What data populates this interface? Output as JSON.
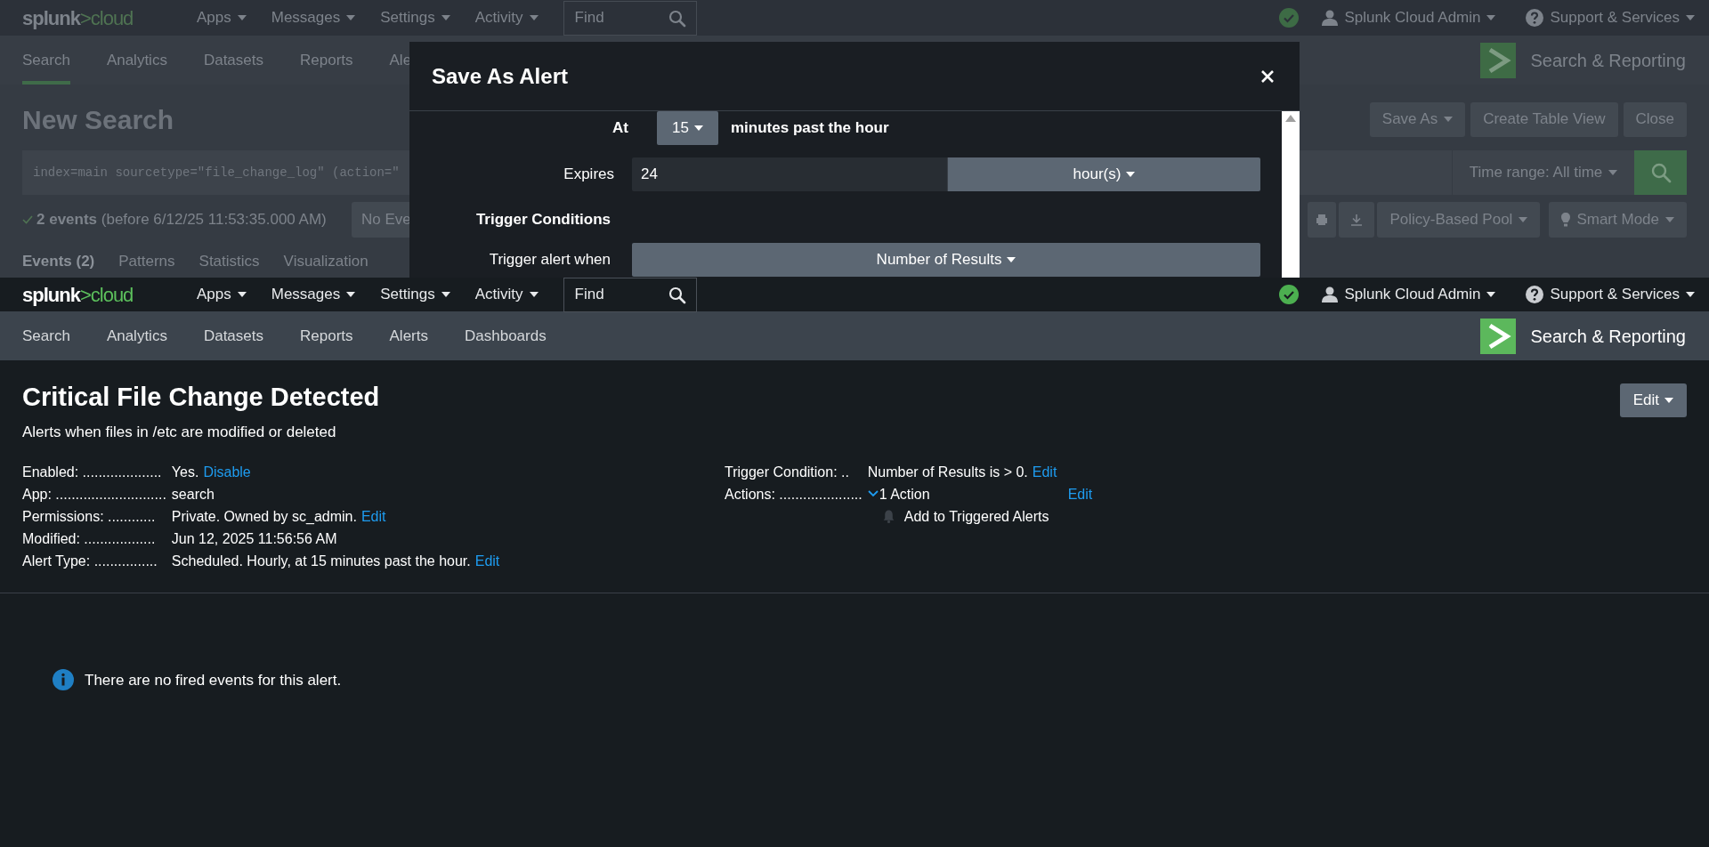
{
  "background_page": {
    "navbar": {
      "logo": {
        "word": "splunk",
        "suffix": ">cloud"
      },
      "menus": [
        "Apps",
        "Messages",
        "Settings",
        "Activity"
      ],
      "find_placeholder": "Find",
      "user": "Splunk Cloud Admin",
      "support": "Support & Services"
    },
    "app_nav": {
      "tabs": [
        {
          "label": "Search",
          "selected": true
        },
        {
          "label": "Analytics",
          "selected": false
        },
        {
          "label": "Datasets",
          "selected": false
        },
        {
          "label": "Reports",
          "selected": false
        },
        {
          "label": "Ale",
          "selected": false
        }
      ],
      "app_name": "Search & Reporting"
    },
    "title": "New Search",
    "actions": [
      {
        "label": "Save As",
        "dropdown": true
      },
      {
        "label": "Create Table View",
        "dropdown": false
      },
      {
        "label": "Close",
        "dropdown": false
      }
    ],
    "query": "index=main sourcetype=\"file_change_log\" (action=\"",
    "time_range": "Time range: All time",
    "events": {
      "count": "2 events",
      "detail": "(before 6/12/25 11:53:35.000 AM)"
    },
    "event_sampling": "No Eve",
    "toolbar": [
      "Policy-Based Pool",
      "Smart Mode"
    ],
    "result_tabs": [
      {
        "label": "Events (2)",
        "selected": true
      },
      {
        "label": "Patterns",
        "selected": false
      },
      {
        "label": "Statistics",
        "selected": false
      },
      {
        "label": "Visualization",
        "selected": false
      }
    ]
  },
  "modal": {
    "title": "Save As Alert",
    "rows": [
      {
        "kind": "minute",
        "label": "At",
        "value": "15",
        "suffix": "minutes past the hour"
      },
      {
        "kind": "expires",
        "label": "Expires",
        "value": "24",
        "unit": "hour(s)"
      },
      {
        "kind": "heading",
        "label": "Trigger Conditions"
      },
      {
        "kind": "select",
        "label": "Trigger alert when",
        "value": "Number of Results"
      }
    ]
  },
  "page": {
    "navbar": {
      "logo": {
        "word": "splunk",
        "suffix": ">cloud"
      },
      "menus": [
        "Apps",
        "Messages",
        "Settings",
        "Activity"
      ],
      "find_placeholder": "Find",
      "user": "Splunk Cloud Admin",
      "support": "Support & Services"
    },
    "app_nav": {
      "tabs": [
        {
          "label": "Search",
          "selected": false
        },
        {
          "label": "Analytics",
          "selected": false
        },
        {
          "label": "Datasets",
          "selected": false
        },
        {
          "label": "Reports",
          "selected": false
        },
        {
          "label": "Alerts",
          "selected": false
        },
        {
          "label": "Dashboards",
          "selected": false
        }
      ],
      "app_name": "Search & Reporting"
    },
    "title": "Critical File Change Detected",
    "description": "Alerts when files in /etc are modified or deleted",
    "edit_button": "Edit",
    "details": [
      {
        "label": "Enabled: ....................",
        "value": "Yes.",
        "link": "Disable"
      },
      {
        "label": "App: ............................",
        "value": "search"
      },
      {
        "label": "Permissions: ............",
        "value": "Private. Owned by sc_admin.",
        "link": "Edit"
      },
      {
        "label": "Modified: ..................",
        "value": "Jun 12, 2025 11:56:56 AM"
      },
      {
        "label": "Alert Type: ................",
        "value": "Scheduled. Hourly, at 15 minutes past the hour.",
        "link": "Edit"
      }
    ],
    "trigger": {
      "label": "Trigger Condition: ..",
      "value": "Number of Results is > 0.",
      "link": "Edit"
    },
    "actions": {
      "label": "Actions: .....................",
      "summary": "1 Action",
      "expanded": true,
      "link": "Edit",
      "items": [
        "Add to Triggered Alerts"
      ]
    },
    "message": "There are no fired events for this alert."
  }
}
